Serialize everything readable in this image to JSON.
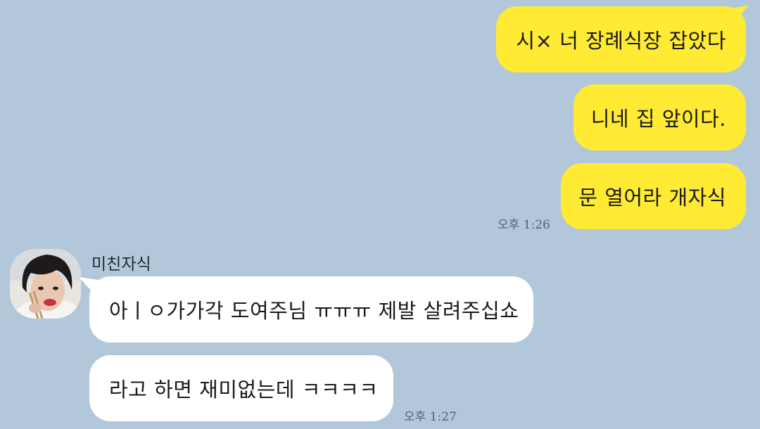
{
  "chat": {
    "sent_messages": [
      "시× 너 장례식장 잡았다",
      "니네 집 앞이다.",
      "문 열어라 개자식"
    ],
    "sent_time": "오후 1:26",
    "sender": {
      "name": "미친자식",
      "avatar": "profile-photo"
    },
    "received_messages": [
      "아ㅣㅇ가가각 도여주님 ㅠㅠㅠ 제발 살려주십쇼",
      "라고 하면 재미없는데 ㅋㅋㅋㅋ"
    ],
    "received_time": "오후 1:27"
  },
  "colors": {
    "background": "#b2c7d9",
    "sent_bubble": "#ffeb33",
    "received_bubble": "#ffffff"
  }
}
